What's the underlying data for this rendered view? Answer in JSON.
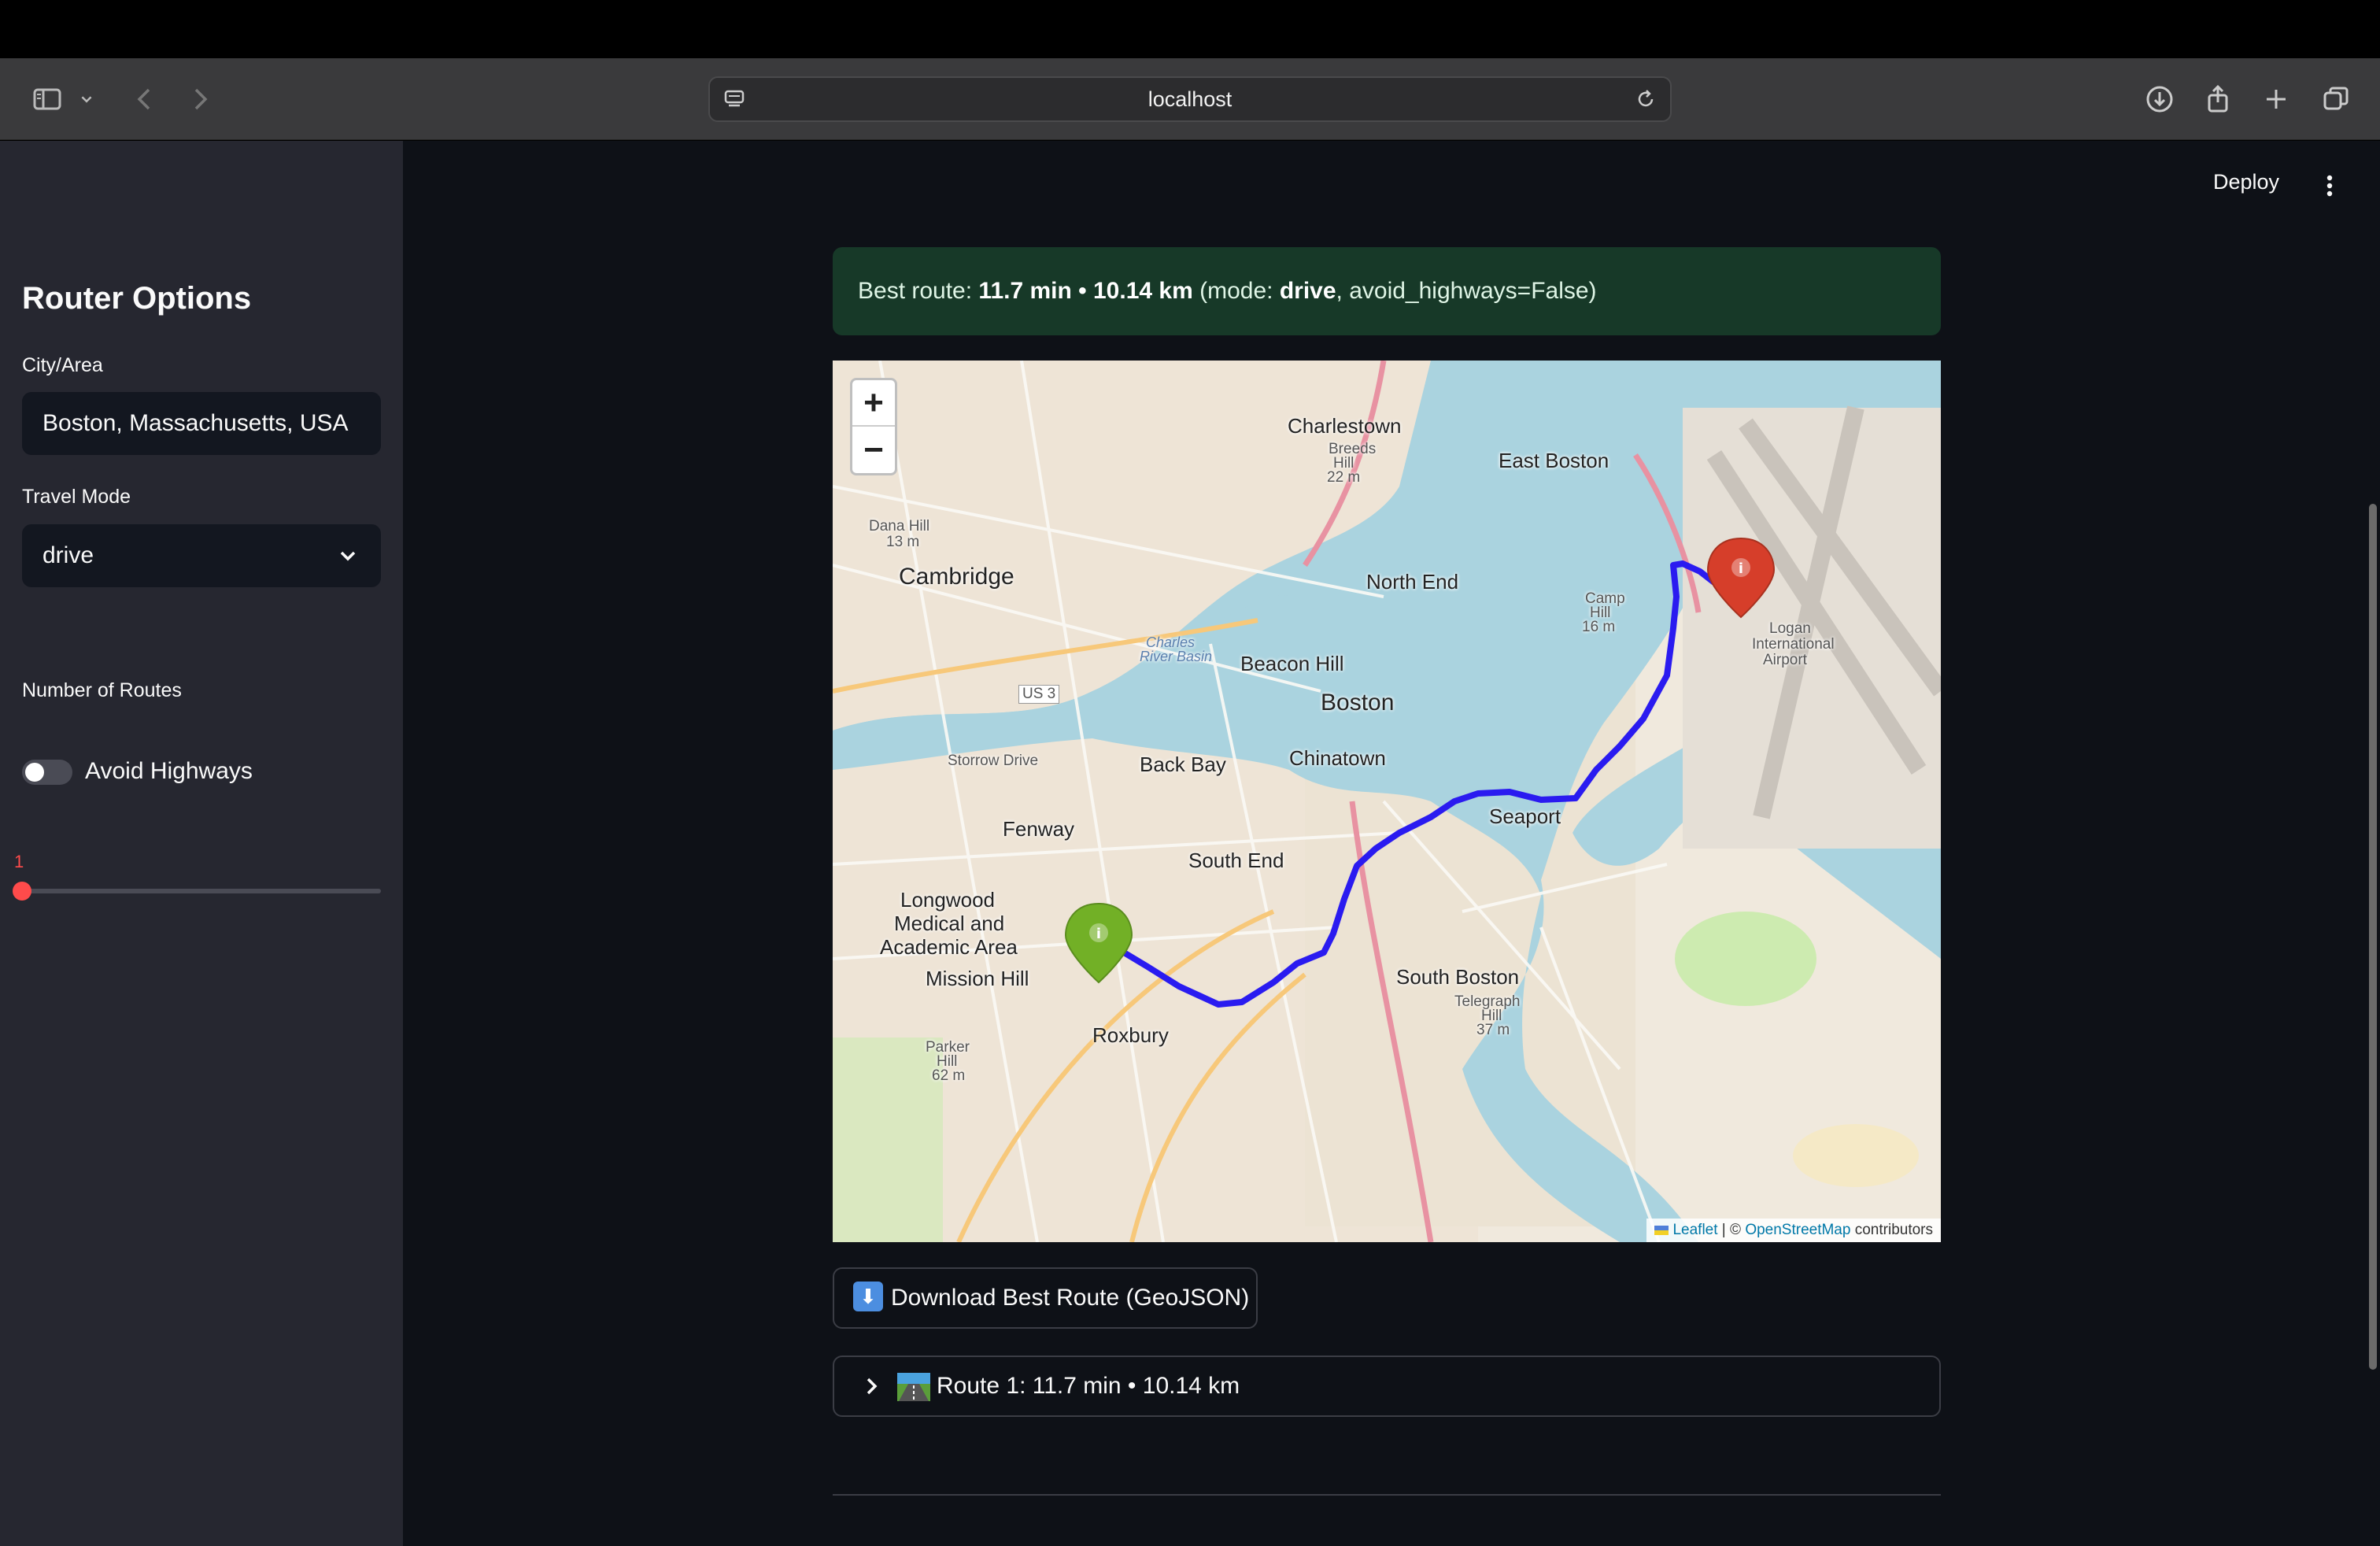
{
  "browser": {
    "url": "localhost",
    "icons": [
      "sidebar-toggle-icon",
      "chevron-down-icon",
      "back-icon",
      "forward-icon",
      "site-settings-icon",
      "reload-icon",
      "download-icon",
      "share-icon",
      "new-tab-icon",
      "tabs-overview-icon"
    ]
  },
  "sidebar": {
    "title": "Router Options",
    "city_label": "City/Area",
    "city_value": "Boston, Massachusetts, USA",
    "mode_label": "Travel Mode",
    "mode_value": "drive",
    "avoid_label": "Avoid Highways",
    "avoid_on": false,
    "routes_label": "Number of Routes",
    "routes_value": "1",
    "routes_fraction": 0.0
  },
  "header": {
    "deploy_label": "Deploy"
  },
  "result": {
    "prefix": "Best route: ",
    "summary": "11.7 min • 10.14 km",
    "mode_open": " (mode: ",
    "mode": "drive",
    "mode_tail": ", avoid_highways=False)"
  },
  "map": {
    "zoom_in": "+",
    "zoom_out": "−",
    "attribution_leaflet": "Leaflet",
    "attribution_sep": " | © ",
    "attribution_osm": "OpenStreetMap",
    "attribution_tail": " contributors",
    "labels": {
      "charlestown": "Charlestown",
      "breeds_hill": "Breeds",
      "breeds_hill2": "Hill",
      "breeds_elev": "22 m",
      "east_boston": "East Boston",
      "cambridge": "Cambridge",
      "dana_hill": "Dana Hill",
      "dana_elev": "13 m",
      "north_end": "North End",
      "camp_hill": "Camp",
      "camp_hill2": "Hill",
      "camp_elev": "16 m",
      "logan": "Logan",
      "logan2": "International",
      "logan3": "Airport",
      "beacon_hill": "Beacon Hill",
      "boston": "Boston",
      "us3": "US 3",
      "back_bay": "Back Bay",
      "chinatown": "Chinatown",
      "fenway": "Fenway",
      "seaport": "Seaport",
      "south_end": "South End",
      "longwood": "Longwood",
      "longwood2": "Medical and",
      "longwood3": "Academic Area",
      "mission_hill": "Mission Hill",
      "south_boston": "South Boston",
      "telegraph": "Telegraph",
      "telegraph2": "Hill",
      "telegraph_elev": "37 m",
      "roxbury": "Roxbury",
      "parker": "Parker",
      "parker2": "Hill",
      "parker_elev": "62 m",
      "storrow": "Storrow Drive",
      "charles_basin": "Charles",
      "charles_basin2": "River Basin"
    }
  },
  "download": {
    "label": "Download Best Route (GeoJSON)"
  },
  "expander": {
    "label": "Route 1: 11.7 min • 10.14 km"
  },
  "colors": {
    "accent": "#ff4b4b",
    "route": "#2a1bf0",
    "success_bg": "#173928",
    "sidebar_bg": "#262730",
    "main_bg": "#0e1117"
  }
}
